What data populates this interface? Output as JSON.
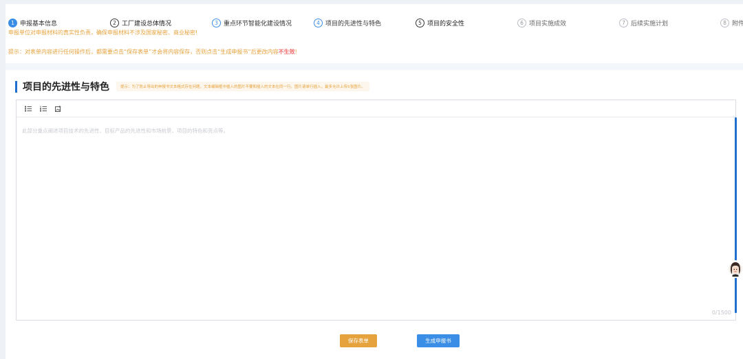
{
  "steps": [
    {
      "num": "1",
      "label": "申报基本信息"
    },
    {
      "num": "2",
      "label": "工厂建设总体情况"
    },
    {
      "num": "3",
      "label": "重点环节智能化建设情况"
    },
    {
      "num": "4",
      "label": "项目的先进性与特色"
    },
    {
      "num": "5",
      "label": "项目的安全性"
    },
    {
      "num": "6",
      "label": "项目实施成效"
    },
    {
      "num": "7",
      "label": "后续实施计划"
    },
    {
      "num": "8",
      "label": "附件"
    }
  ],
  "notices": {
    "line1": "申报单位对申报材料的真实性负责，确保申报材料不涉及国家秘密、商业秘密!",
    "line2_prefix": "提示：对表单内容进行任何操作后，都需要点击“保存表单”才会将内容保存，否则点击“生成申报书”后更改内容",
    "line2_strong": "不生效",
    "line2_suffix": "!"
  },
  "section": {
    "title": "项目的先进性与特色",
    "hint": "提示：为了防止导出的申报书文本格式存在问题，文本编辑框中插入的图片不要和插入的文本在同一行，图片请单行插入，最多允许上传5张图片。"
  },
  "editor": {
    "placeholder": "此部分重点阐述项目技术的先进性、目标产品的先进性和市场前景、项目的特色和亮点等。",
    "counter": "0/1500"
  },
  "toolbar_icons": [
    "bulleted-list-icon",
    "numbered-list-icon",
    "image-upload-icon"
  ],
  "buttons": {
    "save": "保存表单",
    "generate": "生成申报书"
  },
  "colors": {
    "primary": "#3a8ee6",
    "warning": "#e6a23c",
    "danger": "#f56c6c",
    "section_bar": "#1f6fd1"
  }
}
